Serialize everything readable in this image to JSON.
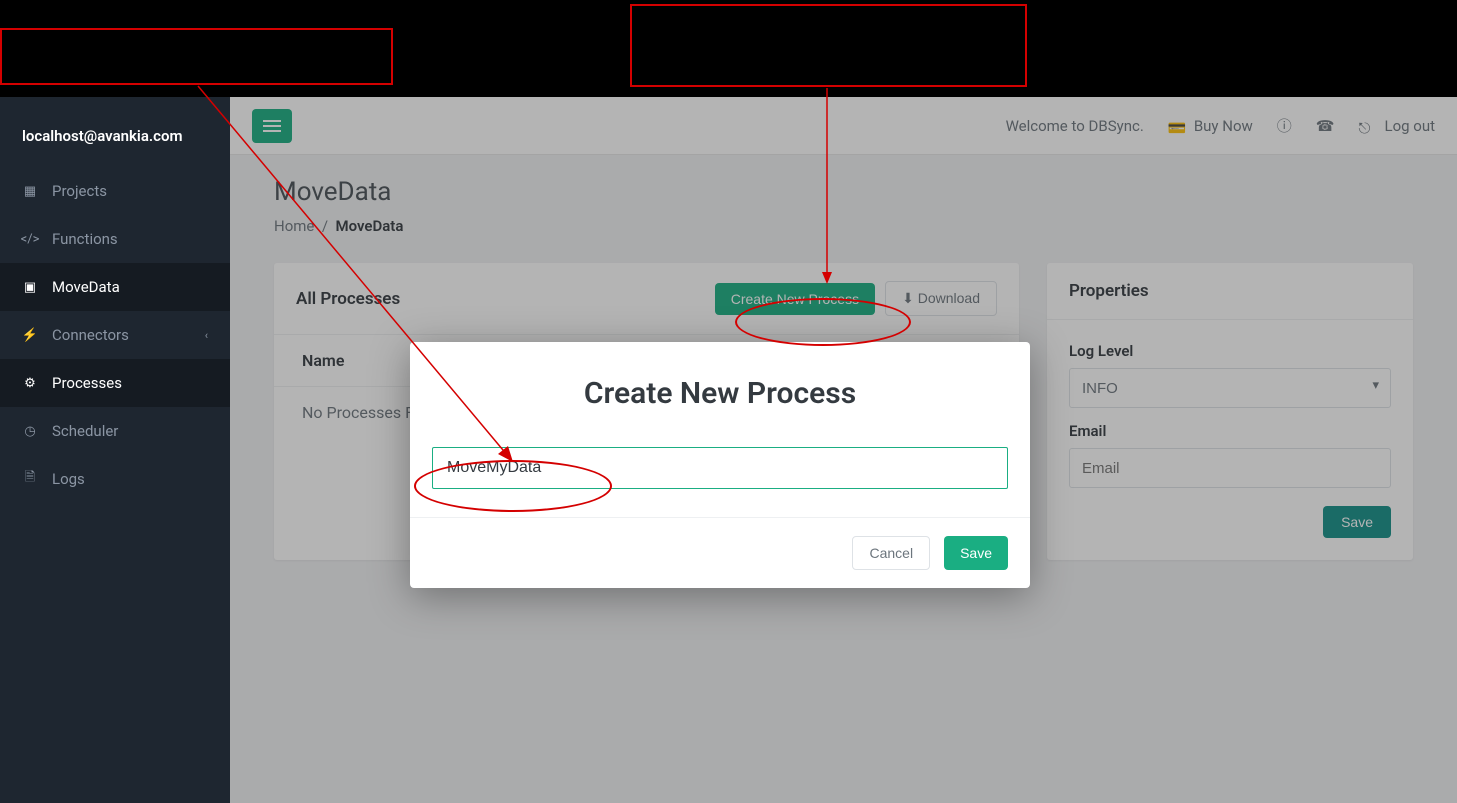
{
  "sidebar": {
    "user": "localhost@avankia.com",
    "items": [
      {
        "label": "Projects",
        "icon": "projects-icon",
        "active": false,
        "chevron": false
      },
      {
        "label": "Functions",
        "icon": "functions-icon",
        "active": false,
        "chevron": false
      },
      {
        "label": "MoveData",
        "icon": "movedata-icon",
        "active": true,
        "chevron": false
      },
      {
        "label": "Connectors",
        "icon": "connectors-icon",
        "active": false,
        "chevron": true
      },
      {
        "label": "Processes",
        "icon": "processes-icon",
        "active": true,
        "chevron": false
      },
      {
        "label": "Scheduler",
        "icon": "scheduler-icon",
        "active": false,
        "chevron": false
      },
      {
        "label": "Logs",
        "icon": "logs-icon",
        "active": false,
        "chevron": false
      }
    ]
  },
  "topbar": {
    "welcome": "Welcome to DBSync.",
    "buy_now": "Buy Now",
    "log_out": "Log out"
  },
  "page": {
    "title": "MoveData",
    "breadcrumb_home": "Home",
    "breadcrumb_sep": "/",
    "breadcrumb_current": "MoveData"
  },
  "processes_panel": {
    "title": "All Processes",
    "create_btn": "Create New Process",
    "download_btn": "Download",
    "col_name": "Name",
    "empty": "No Processes Fo"
  },
  "properties_panel": {
    "title": "Properties",
    "log_level_label": "Log Level",
    "log_level_value": "INFO",
    "email_label": "Email",
    "email_placeholder": "Email",
    "save_btn": "Save"
  },
  "modal": {
    "title": "Create New Process",
    "input_value": "MoveMyData",
    "cancel": "Cancel",
    "save": "Save"
  },
  "annotations": {
    "box1": "",
    "box2": ""
  }
}
